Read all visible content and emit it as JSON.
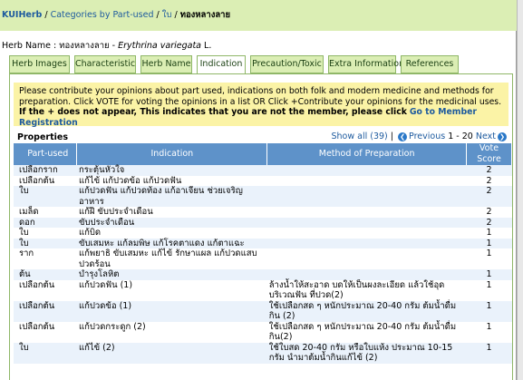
{
  "breadcrumb": {
    "site": "KUIHerb",
    "sep": " / ",
    "categories": "Categories by Part-used",
    "part": "ใบ",
    "current": "ทองหลางลาย"
  },
  "herb": {
    "label": "Herb Name : ",
    "thai": "ทองหลางลาย",
    "dash": " - ",
    "scientific": "Erythrina variegata",
    "author": " L."
  },
  "tabs": [
    {
      "label": "Herb Images"
    },
    {
      "label": "Characteristic"
    },
    {
      "label": "Herb Name"
    },
    {
      "label": "Indication"
    },
    {
      "label": "Precaution/Toxic"
    },
    {
      "label": "Extra Information"
    },
    {
      "label": "References"
    }
  ],
  "notice": {
    "text": "Please contribute your opinions about part used, indications on both folk and modern medicine and methods for preparation. Click VOTE for voting the opinions in a list OR Click +Contribute your opinions for the medicinal uses.",
    "bold_text": " If the + does not appear, This indicates that you are not the member, please click",
    "link": "Go to Member Registration"
  },
  "properties": {
    "title": "Properties",
    "show_all": "Show all (39)",
    "previous": "Previous",
    "range": "1 - 20",
    "next": "Next"
  },
  "table": {
    "headers": [
      "Part-used",
      "Indication",
      "Method of Preparation",
      "Vote Score"
    ],
    "rows": [
      {
        "part": "เปลือกราก",
        "indication": "กระตุ้นหัวใจ",
        "method": "",
        "score": "2"
      },
      {
        "part": "เปลือกต้น",
        "indication": "แก้ไข้ แก้ปวดข้อ แก้ปวดฟัน",
        "method": "",
        "score": "2"
      },
      {
        "part": "ใบ",
        "indication": "แก้ปวดฟัน แก้ปวดท้อง แก้อาเจียน ช่วยเจริญอาหาร",
        "method": "",
        "score": "2"
      },
      {
        "part": "เมล็ด",
        "indication": "แก้ฝี ขับประจำเดือน",
        "method": "",
        "score": "2"
      },
      {
        "part": "ดอก",
        "indication": "ขับประจำเดือน",
        "method": "",
        "score": "2"
      },
      {
        "part": "ใบ",
        "indication": "แก้บิด",
        "method": "",
        "score": "1"
      },
      {
        "part": "ใบ",
        "indication": "ขับเสมหะ แก้ลมพิษ แก้โรคตาแดง แก้ตาแฉะ",
        "method": "",
        "score": "1"
      },
      {
        "part": "ราก",
        "indication": "แก้พยาธิ ขับเสมหะ แก้ไข้ รักษาแผล แก้ปวดแสบปวดร้อน",
        "method": "",
        "score": "1"
      },
      {
        "part": "ต้น",
        "indication": "บำรุงโลหิต",
        "method": "",
        "score": "1"
      },
      {
        "part": "เปลือกต้น",
        "indication": "แก้ปวดฟัน (1)",
        "method": "ล้างน้ำให้สะอาด บดให้เป็นผงละเอียด แล้วใช้อุดบริเวณฟัน ที่ปวด(2)",
        "score": "1"
      },
      {
        "part": "เปลือกต้น",
        "indication": "แก้ปวดข้อ (1)",
        "method": "ใช้เปลือกสด ๆ หนักประมาณ 20-40 กรัม ต้มน้ำดื่มกิน (2)",
        "score": "1"
      },
      {
        "part": "เปลือกต้น",
        "indication": "แก้ปวดกระดูก (2)",
        "method": "ใช้เปลือกสด ๆ หนักประมาณ 20-40 กรัม ต้มน้ำดื่มกิน(2)",
        "score": "1"
      },
      {
        "part": "ใบ",
        "indication": "แก้ไข้ (2)",
        "method": "ใช้ใบสด 20-40 กรัม หรือใบแห้ง ประมาณ 10-15 กรัม นำมาต้มน้ำกินแก้ไข้ (2)",
        "score": "1"
      }
    ]
  }
}
